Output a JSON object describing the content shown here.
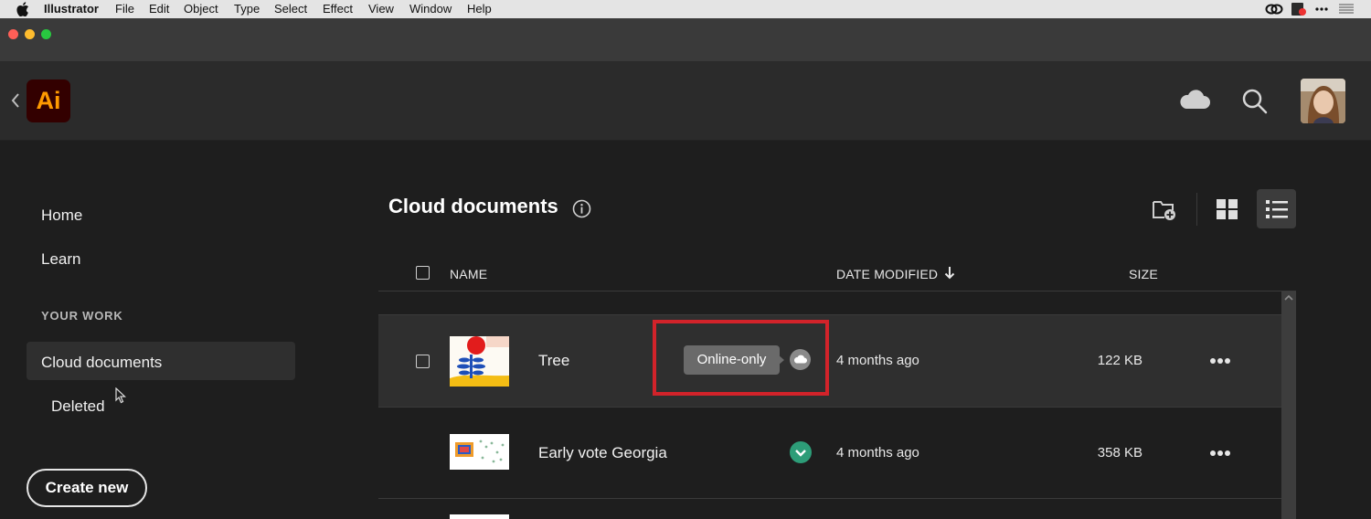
{
  "menubar": {
    "app_name": "Illustrator",
    "items": [
      "File",
      "Edit",
      "Object",
      "Type",
      "Select",
      "Effect",
      "View",
      "Window",
      "Help"
    ],
    "right_icons": [
      "creative-cloud-icon",
      "app-badge-icon",
      "ellipsis-icon",
      "list-menu-icon"
    ]
  },
  "window": {
    "traffic_lights": {
      "close": "#ff5f57",
      "minimize": "#febc2e",
      "zoom": "#28c840"
    }
  },
  "header": {
    "logo_text": "Ai",
    "logo_colors": {
      "background": "#330000",
      "text": "#ff9a00"
    },
    "icons": [
      "back-chevron-icon",
      "cloud-icon",
      "search-icon",
      "avatar"
    ]
  },
  "sidebar": {
    "home": "Home",
    "learn": "Learn",
    "section_label": "YOUR WORK",
    "cloud_documents": "Cloud documents",
    "deleted": "Deleted",
    "create_new": "Create new"
  },
  "main": {
    "title": "Cloud documents",
    "columns": {
      "name": "NAME",
      "date_modified": "DATE MODIFIED",
      "size": "SIZE"
    },
    "sort": {
      "column": "DATE MODIFIED",
      "direction": "descending"
    },
    "view_mode": "list",
    "rows": [
      {
        "name": "Tree",
        "date": "4 months ago",
        "size": "122 KB",
        "status": "online-only",
        "tooltip": "Online-only",
        "selected": true
      },
      {
        "name": "Early vote Georgia",
        "date": "4 months ago",
        "size": "358 KB",
        "status": "synced",
        "selected": false
      }
    ]
  },
  "annotation": {
    "highlight_color": "#d2232a"
  }
}
